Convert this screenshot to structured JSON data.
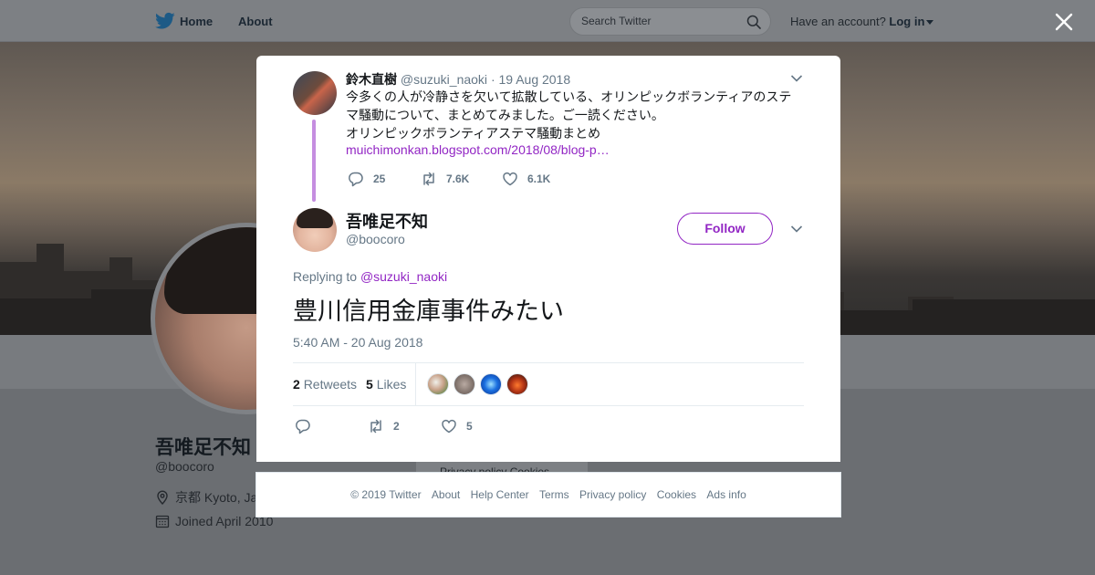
{
  "topbar": {
    "home_label": "Home",
    "about_label": "About",
    "search_placeholder": "Search Twitter",
    "have_account": "Have an account?",
    "login_label": "Log in"
  },
  "profile": {
    "name": "吾唯足不知",
    "handle": "@boocoro",
    "location": "京都 Kyoto, Ja",
    "joined": "Joined April 2010",
    "side_links": "Privacy policy   Cookies"
  },
  "parent_tweet": {
    "author_name": "鈴木直樹",
    "author_handle": "@suzuki_naoki",
    "separator": "·",
    "date": "19 Aug 2018",
    "text_lines": [
      "今多くの人が冷静さを欠いて拡散している、オリンピックボランティアのステ",
      "マ騒動について、まとめてみました。ご一読ください。",
      "オリンピックボランティアステマ騒動まとめ"
    ],
    "link": "muichimonkan.blogspot.com/2018/08/blog-p…",
    "replies": "25",
    "retweets": "7.6K",
    "likes": "6.1K"
  },
  "main_tweet": {
    "author_name": "吾唯足不知",
    "author_handle": "@boocoro",
    "follow_label": "Follow",
    "replying_prefix": "Replying to",
    "replying_handle": "@suzuki_naoki",
    "text": "豊川信用金庫事件みたい",
    "timestamp": "5:40 AM - 20 Aug 2018",
    "retweet_count": "2",
    "retweet_label": "Retweets",
    "like_count": "5",
    "like_label": "Likes",
    "action_retweets": "2",
    "action_likes": "5"
  },
  "footer": {
    "copyright": "© 2019 Twitter",
    "links": [
      "About",
      "Help Center",
      "Terms",
      "Privacy policy",
      "Cookies",
      "Ads info"
    ]
  },
  "icons": {
    "twitter_logo": "twitter-bird-icon",
    "close": "close-icon",
    "reply": "reply-icon",
    "retweet": "retweet-icon",
    "like": "heart-icon",
    "caret": "chevron-down-icon"
  },
  "colors": {
    "accent": "#9226c4",
    "thread_line": "#c58ee0",
    "twitter_blue": "#1da1f2",
    "muted": "#657786"
  }
}
